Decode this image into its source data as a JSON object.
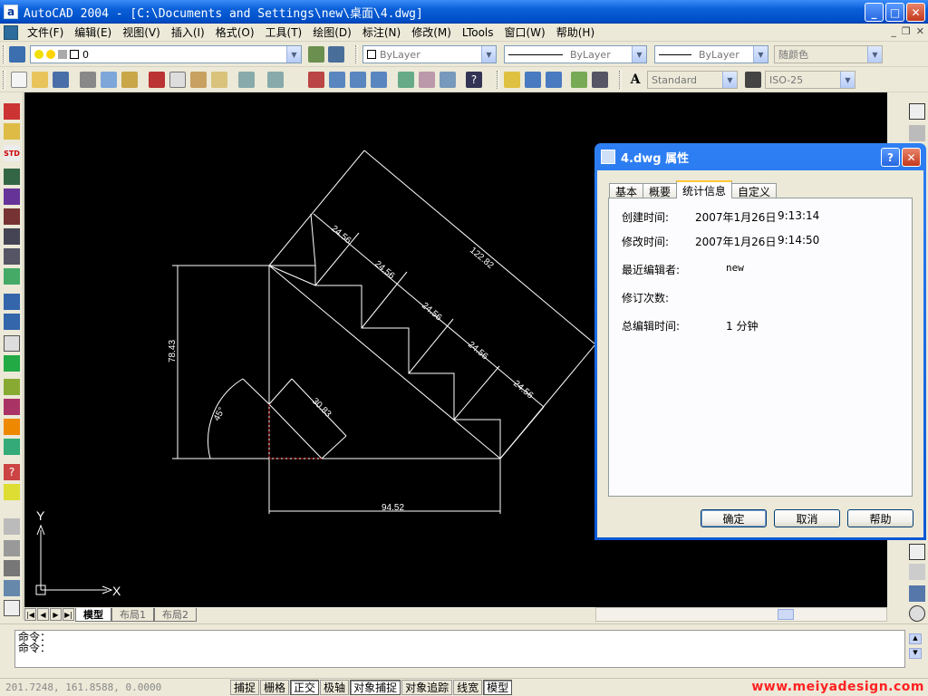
{
  "app": {
    "title": "AutoCAD 2004 - [C:\\Documents and Settings\\new\\桌面\\4.dwg]",
    "icon": "autocad-app-icon"
  },
  "window_controls": {
    "minimize": "_",
    "maximize": "□",
    "close": "✕"
  },
  "mdi_controls": {
    "minimize": "_",
    "restore": "❐",
    "close": "✕"
  },
  "menu": [
    "文件(F)",
    "编辑(E)",
    "视图(V)",
    "插入(I)",
    "格式(O)",
    "工具(T)",
    "绘图(D)",
    "标注(N)",
    "修改(M)",
    "LTools",
    "窗口(W)",
    "帮助(H)"
  ],
  "layers_toolbar": {
    "layer_value": "0"
  },
  "properties_toolbar": {
    "color": "ByLayer",
    "linetype": "ByLayer",
    "lineweight": "ByLayer",
    "plotstyle": "随颜色"
  },
  "styles_toolbar": {
    "text_style": "Standard",
    "dim_style": "ISO-25"
  },
  "drawing": {
    "dimensions": {
      "overall_width": "94.52",
      "overall_height": "78.43",
      "hypotenuse": "122.82",
      "step_1": "24.56",
      "step_2": "24.56",
      "step_3": "24.56",
      "step_4": "24.56",
      "step_5": "24.56",
      "inner": "30.83",
      "angle": "45°"
    },
    "ucs": {
      "x": "X",
      "y": "Y"
    },
    "colors": {
      "background": "#000000",
      "lines": "#ffffff",
      "hidden": "#cc2222"
    }
  },
  "layout_tabs": [
    "模型",
    "布局1",
    "布局2"
  ],
  "command": {
    "line1": "命令：",
    "line2": "命令："
  },
  "status": {
    "coords": "201.7248,  161.8588,  0.0000",
    "toggles": [
      {
        "label": "捕捉",
        "on": false
      },
      {
        "label": "栅格",
        "on": false
      },
      {
        "label": "正交",
        "on": true
      },
      {
        "label": "极轴",
        "on": false
      },
      {
        "label": "对象捕捉",
        "on": true
      },
      {
        "label": "对象追踪",
        "on": false
      },
      {
        "label": "线宽",
        "on": false
      },
      {
        "label": "模型",
        "on": true
      }
    ],
    "watermark": "www.meiyadesign.com"
  },
  "dialog": {
    "title": "4.dwg 属性",
    "help_btn": "?",
    "close_btn": "✕",
    "tabs": [
      "基本",
      "概要",
      "统计信息",
      "自定义"
    ],
    "selected_tab": "统计信息",
    "fields": {
      "created_label": "创建时间:",
      "created_date": "2007年1月26日",
      "created_time": "9:13:14",
      "modified_label": "修改时间:",
      "modified_date": "2007年1月26日",
      "modified_time": "9:14:50",
      "last_editor_label": "最近编辑者:",
      "last_editor_value": "new",
      "revision_label": "修订次数:",
      "revision_value": "",
      "edit_time_label": "总编辑时间:",
      "edit_time_value": "1 分钟"
    },
    "buttons": {
      "ok": "确定",
      "cancel": "取消",
      "help": "帮助"
    }
  }
}
